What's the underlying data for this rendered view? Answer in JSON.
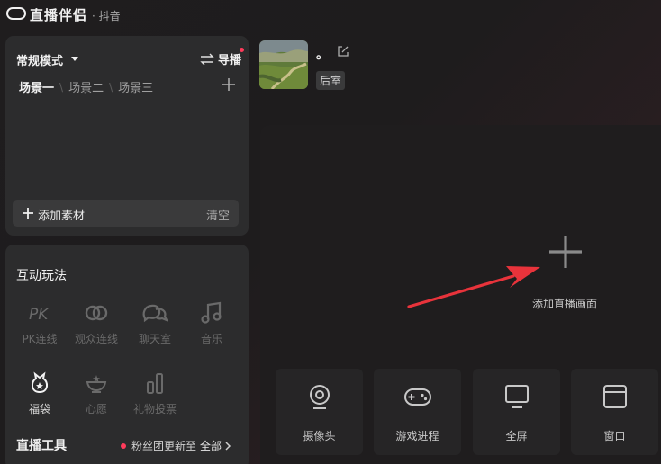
{
  "titlebar": {
    "app_name": "直播伴侣",
    "platform": "· 抖音"
  },
  "scene_panel": {
    "mode": "常规模式",
    "guide": "导播",
    "tabs": [
      "场景一",
      "场景二",
      "场景三"
    ],
    "add_material": "添加素材",
    "clear": "清空"
  },
  "interaction_panel": {
    "title": "互动玩法",
    "tools_row1": [
      {
        "label": "PK连线",
        "icon": "pk-icon"
      },
      {
        "label": "观众连线",
        "icon": "link-icon"
      },
      {
        "label": "聊天室",
        "icon": "chat-icon"
      },
      {
        "label": "音乐",
        "icon": "music-icon"
      }
    ],
    "tools_row2": [
      {
        "label": "福袋",
        "icon": "lucky-bag-icon"
      },
      {
        "label": "心愿",
        "icon": "wish-icon"
      },
      {
        "label": "礼物投票",
        "icon": "vote-icon"
      }
    ],
    "live_tools": "直播工具",
    "fans_update": "粉丝团更新至",
    "fans_all": "全部"
  },
  "profile": {
    "name": "。",
    "room": "后室"
  },
  "preview": {
    "add_label": "添加直播画面",
    "sources": [
      {
        "label": "摄像头",
        "icon": "camera-icon"
      },
      {
        "label": "游戏进程",
        "icon": "gamepad-icon"
      },
      {
        "label": "全屏",
        "icon": "monitor-icon"
      },
      {
        "label": "窗口",
        "icon": "window-icon"
      }
    ]
  },
  "colors": {
    "accent": "#ff3b5b",
    "arrow": "#e8333b"
  }
}
